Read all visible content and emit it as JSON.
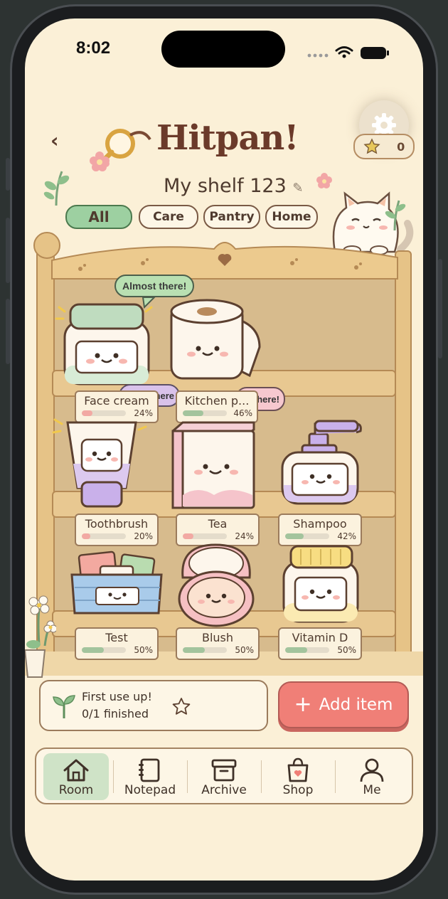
{
  "status": {
    "time": "8:02"
  },
  "header": {
    "title": "Hitpan!",
    "star_count": "0"
  },
  "shelf": {
    "name": "My shelf 123"
  },
  "tabs": [
    {
      "label": "All",
      "active": true
    },
    {
      "label": "Care",
      "active": false
    },
    {
      "label": "Pantry",
      "active": false
    },
    {
      "label": "Home",
      "active": false
    }
  ],
  "bubbles": {
    "main": "Almost there!",
    "left_partial": "here",
    "right_partial": "here!"
  },
  "items": [
    {
      "name": "Face cream",
      "pct": "24%",
      "progress": 0.24,
      "bar_color": "#f2a9a3"
    },
    {
      "name": "Kitchen p...",
      "pct": "46%",
      "progress": 0.46,
      "bar_color": "#a3c49d"
    },
    {
      "name": "Toothbrush",
      "pct": "20%",
      "progress": 0.2,
      "bar_color": "#f2a9a3"
    },
    {
      "name": "Tea",
      "pct": "24%",
      "progress": 0.24,
      "bar_color": "#f2a9a3"
    },
    {
      "name": "Shampoo",
      "pct": "42%",
      "progress": 0.42,
      "bar_color": "#a3c49d"
    },
    {
      "name": "Test",
      "pct": "50%",
      "progress": 0.5,
      "bar_color": "#a3c49d"
    },
    {
      "name": "Blush",
      "pct": "50%",
      "progress": 0.5,
      "bar_color": "#a3c49d"
    },
    {
      "name": "Vitamin D",
      "pct": "50%",
      "progress": 0.5,
      "bar_color": "#a3c49d"
    }
  ],
  "goal": {
    "title": "First use up!",
    "progress": "0/1 finished"
  },
  "add_button": {
    "label": "Add item"
  },
  "nav": [
    {
      "label": "Room",
      "icon": "house-icon",
      "active": true
    },
    {
      "label": "Notepad",
      "icon": "notebook-icon",
      "active": false
    },
    {
      "label": "Archive",
      "icon": "archive-box-icon",
      "active": false
    },
    {
      "label": "Shop",
      "icon": "shopping-bag-icon",
      "active": false
    },
    {
      "label": "Me",
      "icon": "person-icon",
      "active": false
    }
  ],
  "colors": {
    "accent_green": "#9dd0a1",
    "add_button": "#f07f77",
    "title_brown": "#6b3a2a",
    "background": "#fbf0d7"
  }
}
